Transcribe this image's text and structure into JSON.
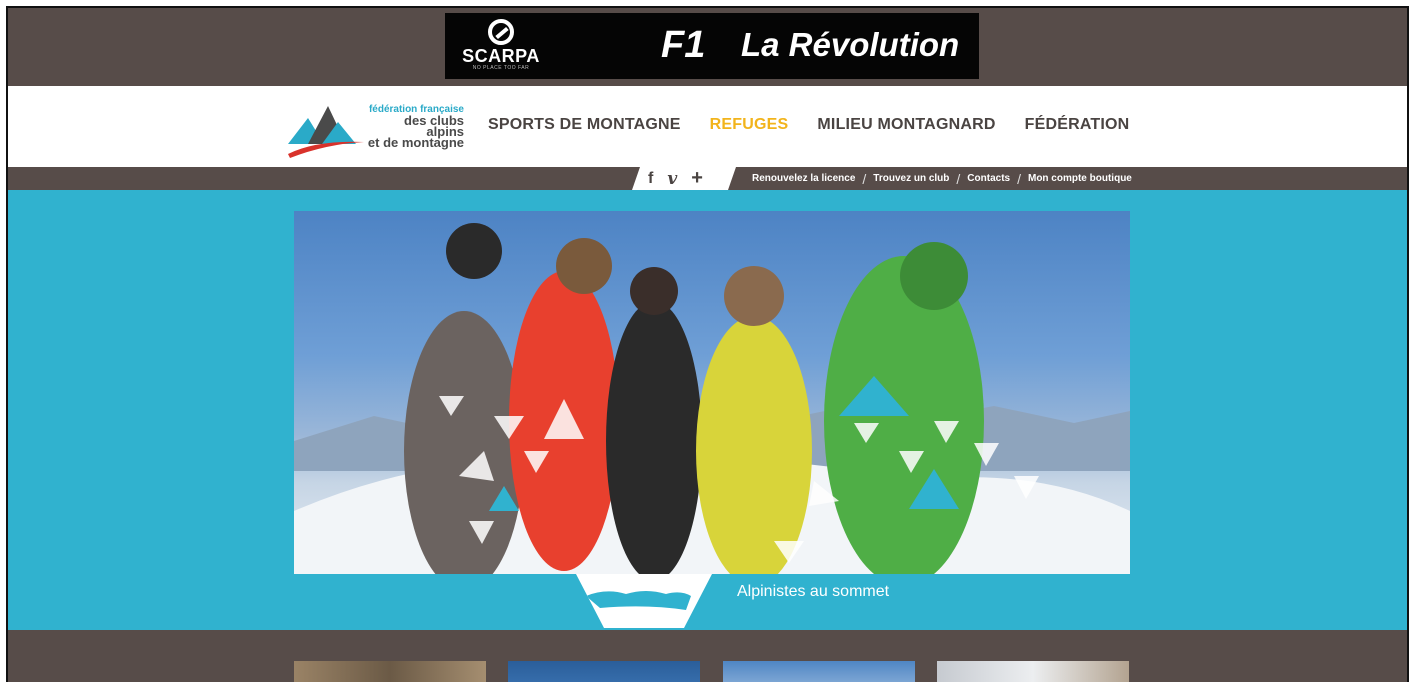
{
  "ad": {
    "brand": "SCARPA",
    "brand_tagline": "NO PLACE TOO FAR",
    "product": "F1",
    "headline": "La Révolution"
  },
  "logo": {
    "line1": "fédération française",
    "line2": "des clubs alpins",
    "line3": "et de montagne"
  },
  "nav": {
    "items": [
      {
        "label": "SPORTS DE MONTAGNE",
        "active": false
      },
      {
        "label": "REFUGES",
        "active": true
      },
      {
        "label": "MILIEU MONTAGNARD",
        "active": false
      },
      {
        "label": "FÉDÉRATION",
        "active": false
      }
    ]
  },
  "social": {
    "facebook": "f",
    "vimeo": "v",
    "more": "+"
  },
  "util_links": [
    "Renouvelez la licence",
    "Trouvez un club",
    "Contacts",
    "Mon compte boutique"
  ],
  "hero": {
    "caption": "Alpinistes au sommet"
  },
  "colors": {
    "brand_dark": "#574c49",
    "accent_blue": "#30b2cf",
    "active_nav": "#f2b41c"
  }
}
